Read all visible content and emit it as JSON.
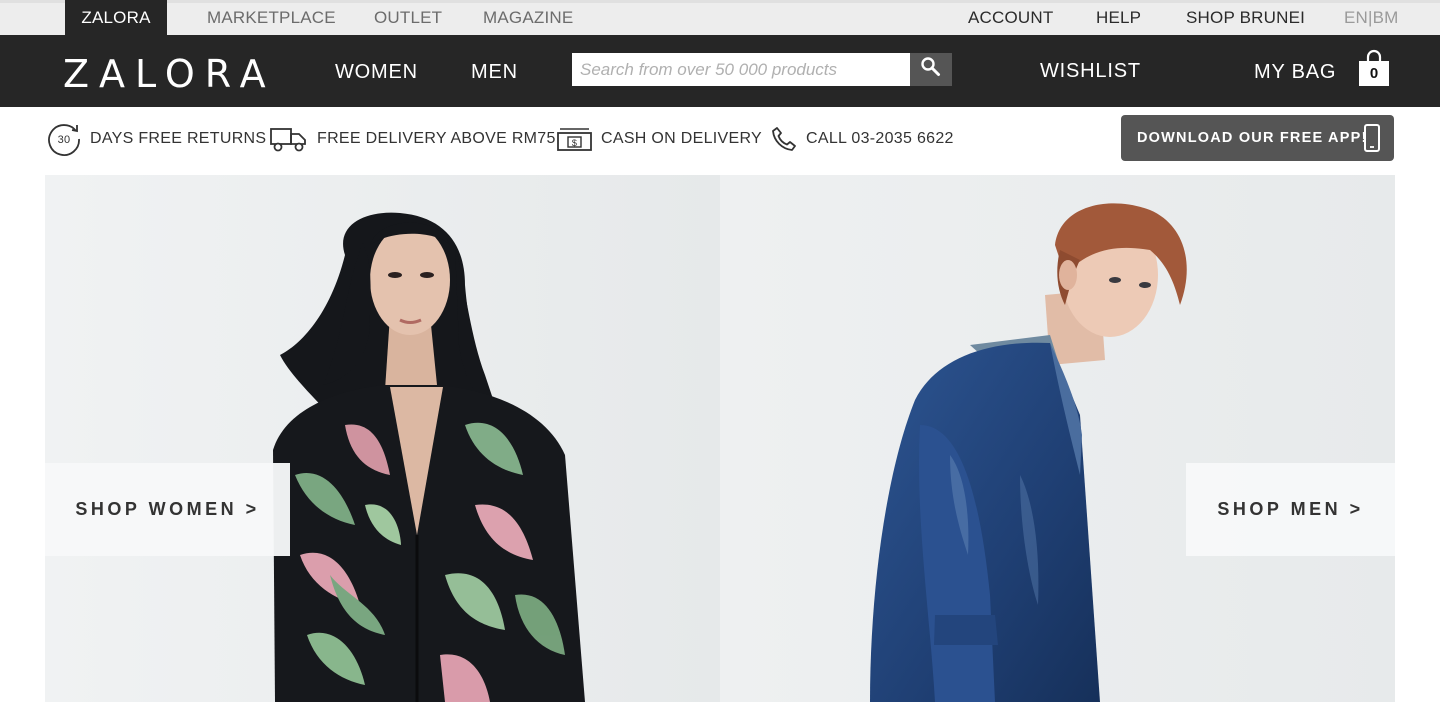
{
  "topbar": {
    "active_tab": "ZALORA",
    "tabs": [
      "MARKETPLACE",
      "OUTLET",
      "MAGAZINE"
    ],
    "right_links": [
      "ACCOUNT",
      "HELP",
      "SHOP BRUNEI"
    ],
    "language": "EN|BM"
  },
  "nav": {
    "logo": "ZALORA",
    "women": "WOMEN",
    "men": "MEN",
    "search_placeholder": "Search from over 50 000 products",
    "wishlist": "WISHLIST",
    "bag": "MY BAG",
    "bag_count": "0"
  },
  "usp": {
    "returns_days": "30",
    "returns": "DAYS FREE RETURNS",
    "delivery": "FREE DELIVERY ABOVE RM75",
    "cash_symbol": "$",
    "cod": "CASH ON DELIVERY",
    "call": "CALL 03-2035 6622"
  },
  "app_button": "DOWNLOAD OUR FREE APP!",
  "hero": {
    "shop_women": "SHOP WOMEN >",
    "shop_men": "SHOP MEN >"
  },
  "colors": {
    "nav_bg": "#262626",
    "topbar_bg": "#ededed",
    "button_grey": "#555555"
  },
  "icons": [
    "search-icon",
    "shopping-bag-icon",
    "returns-icon",
    "truck-icon",
    "cash-icon",
    "phone-icon",
    "mobile-phone-icon"
  ]
}
